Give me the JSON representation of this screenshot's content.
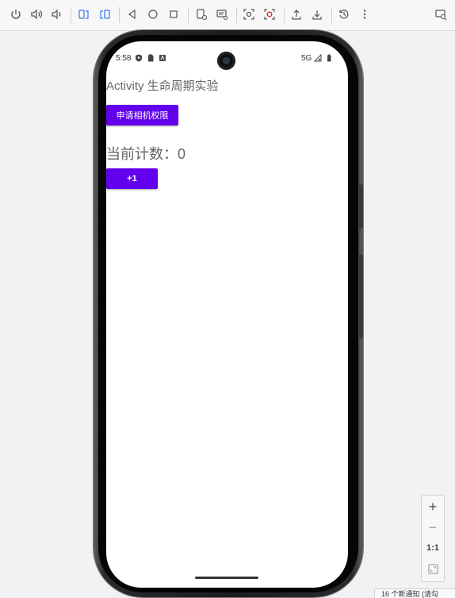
{
  "toolbar": {
    "buttons": [
      {
        "name": "power-icon"
      },
      {
        "name": "volume-up-icon"
      },
      {
        "name": "volume-down-icon"
      },
      {
        "name": "rotate-left-icon"
      },
      {
        "name": "rotate-right-icon"
      },
      {
        "name": "back-icon"
      },
      {
        "name": "home-icon"
      },
      {
        "name": "overview-icon"
      },
      {
        "name": "screenshot-icon"
      },
      {
        "name": "screen-record-icon"
      },
      {
        "name": "camera-snapshot-icon"
      },
      {
        "name": "record-icon"
      },
      {
        "name": "upload-icon"
      },
      {
        "name": "download-icon"
      },
      {
        "name": "history-icon"
      },
      {
        "name": "more-icon"
      },
      {
        "name": "device-manager-icon"
      }
    ],
    "accent_color": "#3574f0"
  },
  "status_bar": {
    "time": "5:58",
    "network": "5G"
  },
  "app": {
    "title": "Activity 生命周期实验",
    "permission_button": "申请相机权限",
    "counter_text": "当前计数：0",
    "plus_button": "+1",
    "button_color": "#6200ee"
  },
  "zoom": {
    "plus": "+",
    "minus": "−",
    "ratio": "1:1"
  },
  "notification": {
    "text": "16 个新通知 (请勾"
  }
}
